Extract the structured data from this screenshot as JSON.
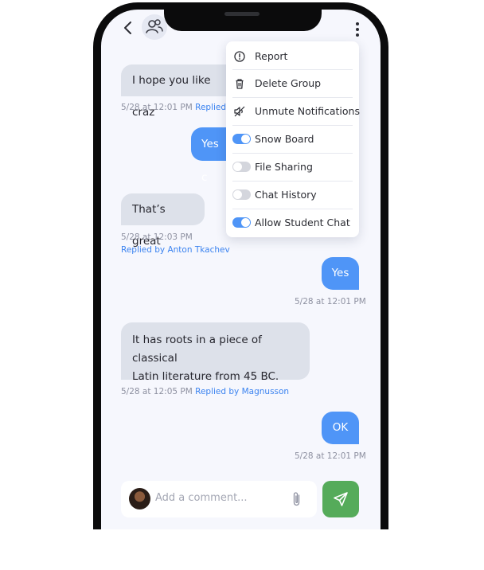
{
  "header": {
    "back_icon": "chevron-left-icon",
    "group_icon": "users-icon",
    "menu_icon": "more-vertical-icon"
  },
  "menu": {
    "items": [
      {
        "label": "Report",
        "icon": "alert-circle-icon"
      },
      {
        "label": "Delete Group",
        "icon": "trash-icon"
      },
      {
        "label": "Unmute Notifications",
        "icon": "volume-off-icon"
      }
    ],
    "toggles": [
      {
        "label": "Snow Board",
        "on": true
      },
      {
        "label": "File Sharing",
        "on": false
      },
      {
        "label": "Chat History",
        "on": false
      },
      {
        "label": "Allow Student Chat",
        "on": true
      }
    ]
  },
  "messages": [
    {
      "text": "I hope you like craz",
      "meta": "5/28 at 12:01 PM",
      "reply": "Replied b"
    },
    {
      "text": "Yes c"
    },
    {
      "text": "That’s great",
      "meta": "5/28 at 12:03 PM",
      "reply": "Replied by Anton Tkachev"
    },
    {
      "text": "Yes",
      "meta": "5/28 at 12:01 PM"
    },
    {
      "text_line1": "It has roots in a piece of classical",
      "text_line2": "Latin literature from 45 BC.",
      "meta": "5/28 at 12:05 PM",
      "reply": "Replied by Magnusson"
    },
    {
      "text": "OK",
      "meta": "5/28 at 12:01 PM"
    }
  ],
  "composer": {
    "placeholder": "Add a comment...",
    "attach_icon": "paperclip-icon",
    "send_icon": "send-icon"
  },
  "colors": {
    "accent": "#4f95f7",
    "send": "#55ab5a",
    "incoming": "#dde1ea",
    "link": "#3b83f0"
  }
}
